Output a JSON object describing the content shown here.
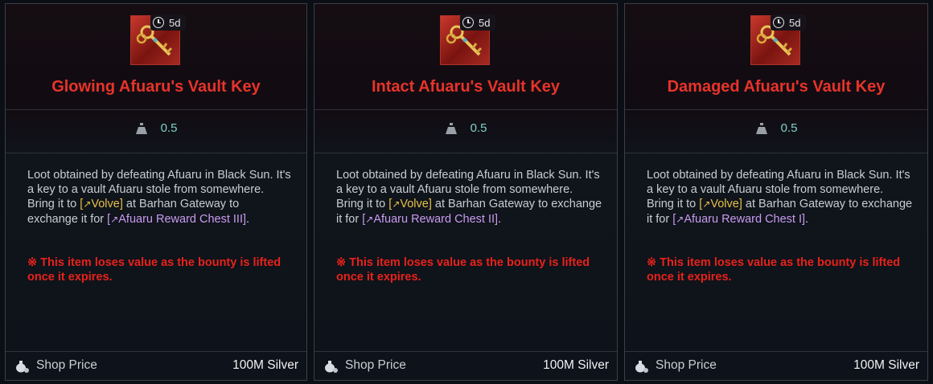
{
  "colors": {
    "title": "#e8332a",
    "weight": "#7fd1c8",
    "npc": "#e6c04a",
    "chest": "#c99cf0",
    "warning": "#e8221a"
  },
  "cards": [
    {
      "timer": "5d",
      "icon": "vault-key-icon",
      "title": "Glowing Afuaru's Vault Key",
      "weight": "0.5",
      "desc_a": "Loot obtained by defeating Afuaru in Black Sun. It's a key to a vault Afuaru stole from somewhere.",
      "bring": "Bring it to",
      "npc": "Volve",
      "at_text": "at Barhan Gateway to exchange it for",
      "chest": "Afuaru Reward Chest III",
      "warning": "※ This item loses value as the bounty is lifted once it expires.",
      "shop_label": "Shop Price",
      "shop_price": "100M Silver"
    },
    {
      "timer": "5d",
      "icon": "vault-key-icon",
      "title": "Intact Afuaru's Vault Key",
      "weight": "0.5",
      "desc_a": "Loot obtained by defeating Afuaru in Black Sun. It's a key to a vault Afuaru stole from somewhere.",
      "bring": "Bring it to",
      "npc": "Volve",
      "at_text": "at Barhan Gateway to exchange it for",
      "chest": "Afuaru Reward Chest II",
      "warning": "※ This item loses value as the bounty is lifted once it expires.",
      "shop_label": "Shop Price",
      "shop_price": "100M Silver"
    },
    {
      "timer": "5d",
      "icon": "vault-key-icon",
      "title": "Damaged Afuaru's Vault Key",
      "weight": "0.5",
      "desc_a": "Loot obtained by defeating Afuaru in Black Sun. It's a key to a vault Afuaru stole from somewhere.",
      "bring": "Bring it to",
      "npc": "Volve",
      "at_text": "at Barhan Gateway to exchange it for",
      "chest": "Afuaru Reward Chest I",
      "warning": "※ This item loses value as the bounty is lifted once it expires.",
      "shop_label": "Shop Price",
      "shop_price": "100M Silver"
    }
  ]
}
